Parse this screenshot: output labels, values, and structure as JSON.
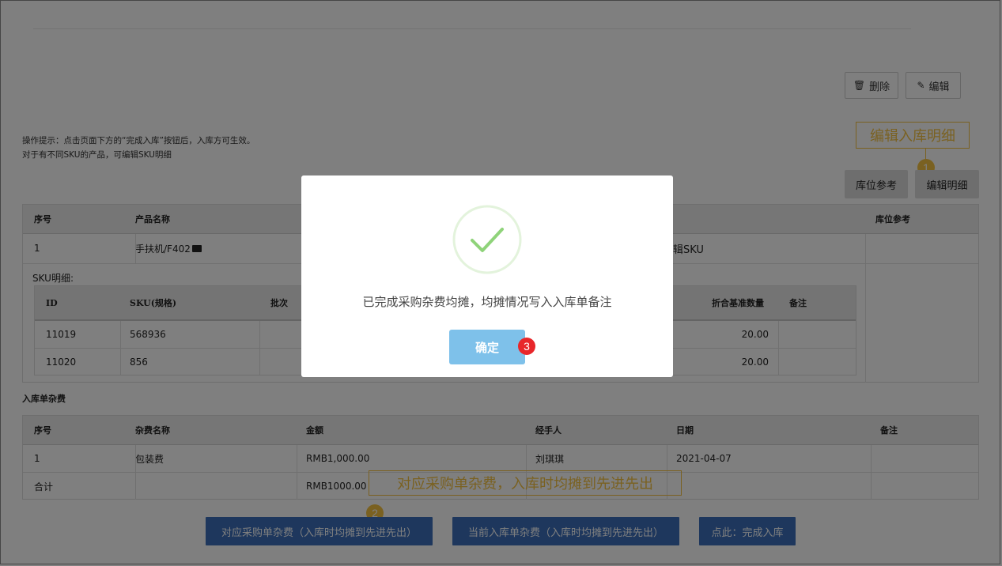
{
  "toolbar": {
    "delete_label": "删除",
    "edit_label": "编辑"
  },
  "hints": {
    "line1": "操作提示：点击页面下方的“完成入库”按钮后，入库方可生效。",
    "line2": "对于有不同SKU的产品，可编辑SKU明细"
  },
  "annotations": {
    "edit_detail_callout": "编辑入库明细",
    "fee_callout": "对应采购单杂费，入库时均摊到先进先出",
    "n1": "1",
    "n2": "2",
    "n3": "3"
  },
  "detail_buttons": {
    "location_ref": "库位参考",
    "edit_detail": "编辑明细"
  },
  "product_table": {
    "headers": {
      "seq": "序号",
      "name": "产品名称",
      "location": "库位参考"
    },
    "row": {
      "seq": "1",
      "name": "手扶机/F402",
      "edit_sku": "辑SKU"
    },
    "sku_label": "SKU明细:",
    "sku_headers": {
      "id": "ID",
      "sku": "SKU(规格)",
      "batch": "批次",
      "base_qty": "折合基准数量",
      "note": "备注"
    },
    "sku_rows": [
      {
        "id": "11019",
        "sku": "568936",
        "base_qty": "20.00"
      },
      {
        "id": "11020",
        "sku": "856",
        "base_qty": "20.00"
      }
    ]
  },
  "fee_section": {
    "title": "入库单杂费",
    "headers": {
      "seq": "序号",
      "name": "杂费名称",
      "amount": "金额",
      "handler": "经手人",
      "date": "日期",
      "note": "备注"
    },
    "rows": [
      {
        "seq": "1",
        "name": "包装费",
        "amount": "RMB1,000.00",
        "handler": "刘琪琪",
        "date": "2021-04-07"
      },
      {
        "seq": "合计",
        "name": "",
        "amount": "RMB1000.00",
        "handler": "",
        "date": ""
      }
    ]
  },
  "bottom_buttons": {
    "purchase_fee": "对应采购单杂费（入库时均摊到先进先出）",
    "current_fee": "当前入库单杂费（入库时均摊到先进先出）",
    "complete": "点此：完成入库"
  },
  "modal": {
    "message": "已完成采购杂费均摊，均摊情况写入入库单备注",
    "ok_label": "确定"
  },
  "colors": {
    "primary": "#3c6fba",
    "annotation": "#f5c343",
    "success": "#8fd37a",
    "badge_red": "#e8262a"
  }
}
